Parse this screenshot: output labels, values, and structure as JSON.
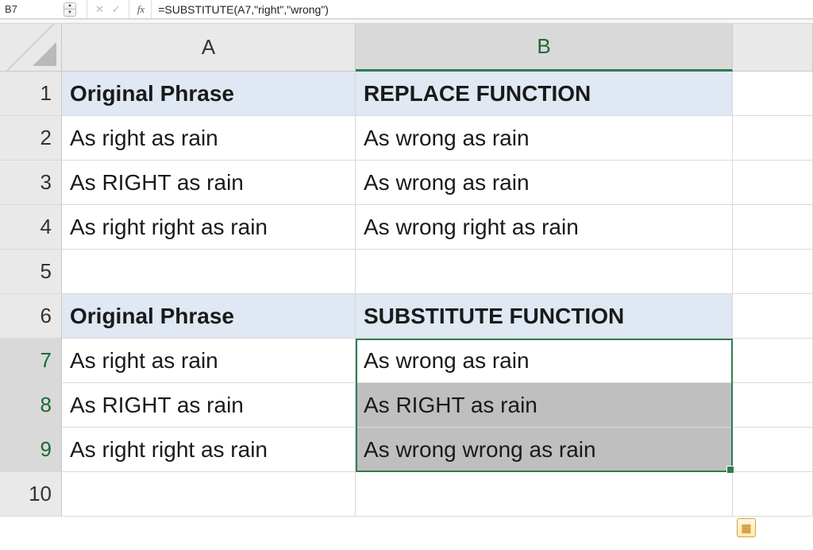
{
  "namebox": "B7",
  "formula": "=SUBSTITUTE(A7,\"right\",\"wrong\")",
  "columns": [
    "A",
    "B",
    ""
  ],
  "rows": [
    "1",
    "2",
    "3",
    "4",
    "5",
    "6",
    "7",
    "8",
    "9",
    "10"
  ],
  "grid": {
    "r1": {
      "A": "Original Phrase",
      "B": "REPLACE FUNCTION"
    },
    "r2": {
      "A": "As right as rain",
      "B": "As wrong as rain"
    },
    "r3": {
      "A": "As RIGHT as rain",
      "B": "As wrong as rain"
    },
    "r4": {
      "A": "As right right as rain",
      "B": "As wrong right as rain"
    },
    "r5": {
      "A": "",
      "B": ""
    },
    "r6": {
      "A": "Original Phrase",
      "B": "SUBSTITUTE FUNCTION"
    },
    "r7": {
      "A": "As right as rain",
      "B": "As wrong as rain"
    },
    "r8": {
      "A": "As RIGHT as rain",
      "B": "As RIGHT as rain"
    },
    "r9": {
      "A": "As right right as rain",
      "B": "As wrong wrong as rain"
    },
    "r10": {
      "A": "",
      "B": ""
    }
  },
  "fx_label": "fx",
  "chart_data": {
    "type": "table",
    "note": "Spreadsheet demonstrating REPLACE vs SUBSTITUTE text functions",
    "columns": [
      "A (Original Phrase)",
      "B (Result)"
    ],
    "sections": [
      {
        "header": [
          "Original Phrase",
          "REPLACE FUNCTION"
        ],
        "rows": [
          [
            "As right as rain",
            "As wrong as rain"
          ],
          [
            "As RIGHT as rain",
            "As wrong as rain"
          ],
          [
            "As right right as rain",
            "As wrong right as rain"
          ]
        ]
      },
      {
        "header": [
          "Original Phrase",
          "SUBSTITUTE FUNCTION"
        ],
        "rows": [
          [
            "As right as rain",
            "As wrong as rain"
          ],
          [
            "As RIGHT as rain",
            "As RIGHT as rain"
          ],
          [
            "As right right as rain",
            "As wrong wrong as rain"
          ]
        ]
      }
    ],
    "active_cell": "B7",
    "formula_bar": "=SUBSTITUTE(A7,\"right\",\"wrong\")",
    "selection": "B7:B9"
  }
}
